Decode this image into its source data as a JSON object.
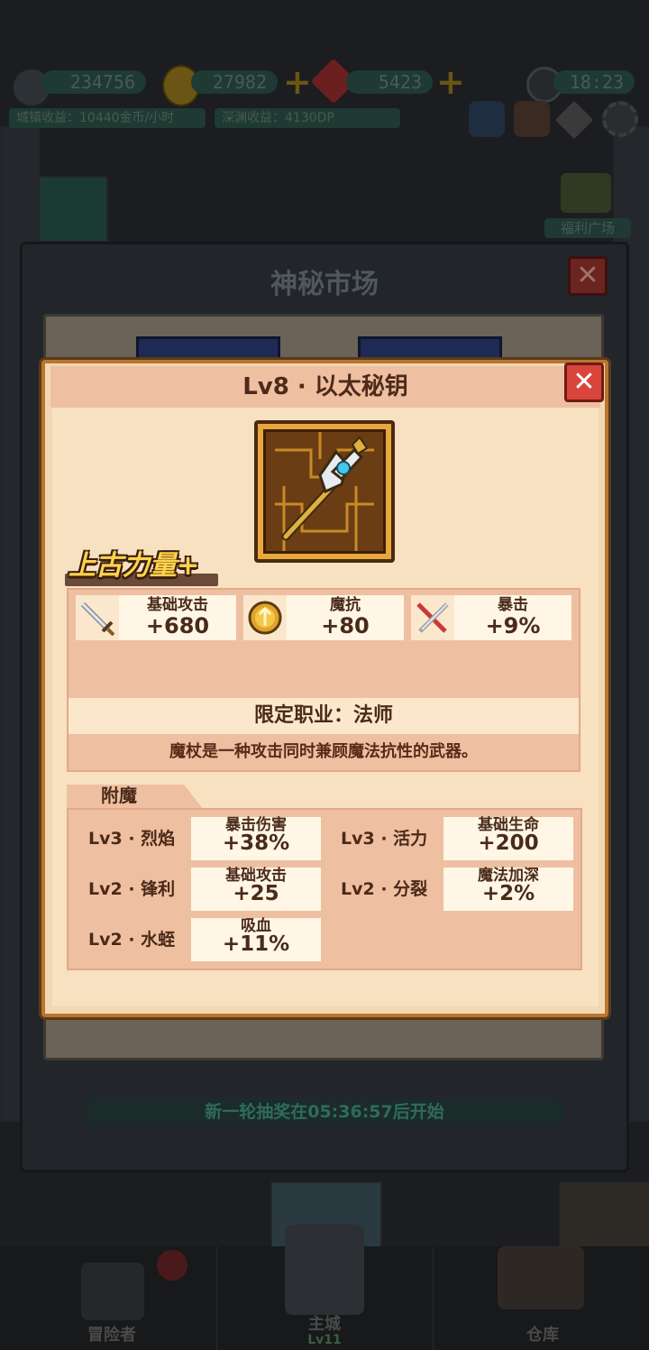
{
  "hud": {
    "power": "234756",
    "gold": "27982",
    "gems": "5423",
    "time": "18:23",
    "town_income": "城镇收益：10440金币/小时",
    "abyss_income": "深渊收益：4130DP",
    "welfare": "福利广场"
  },
  "nav": {
    "adventurer": "冒险者",
    "main_city": "主城",
    "main_city_level": "Lv11",
    "warehouse": "仓库"
  },
  "market": {
    "title": "神秘市场",
    "footer": "新一轮抽奖在05:36:57后开始"
  },
  "item": {
    "title": "Lv8 · 以太秘钥",
    "quality": "上古力量+",
    "stats": [
      {
        "icon": "sword-icon",
        "label": "基础攻击",
        "value": "+680"
      },
      {
        "icon": "magic-resist-icon",
        "label": "魔抗",
        "value": "+80"
      },
      {
        "icon": "crossed-swords-icon",
        "label": "暴击",
        "value": "+9%"
      }
    ],
    "class_restriction": "限定职业：法师",
    "description": "魔杖是一种攻击同时兼顾魔法抗性的武器。",
    "enchant_title": "附魔",
    "enchants": [
      {
        "name": "Lv3 · 烈焰",
        "label": "暴击伤害",
        "value": "+38%"
      },
      {
        "name": "Lv3 · 活力",
        "label": "基础生命",
        "value": "+200"
      },
      {
        "name": "Lv2 · 锋利",
        "label": "基础攻击",
        "value": "+25"
      },
      {
        "name": "Lv2 · 分裂",
        "label": "魔法加深",
        "value": "+2%"
      },
      {
        "name": "Lv2 · 水蛭",
        "label": "吸血",
        "value": "+11%"
      }
    ]
  },
  "colors": {
    "dialog_bg": "#f2d7b4",
    "header_bg": "#efbfa1",
    "close_red": "#d9443b",
    "quality_gold": "#ffd24a"
  }
}
